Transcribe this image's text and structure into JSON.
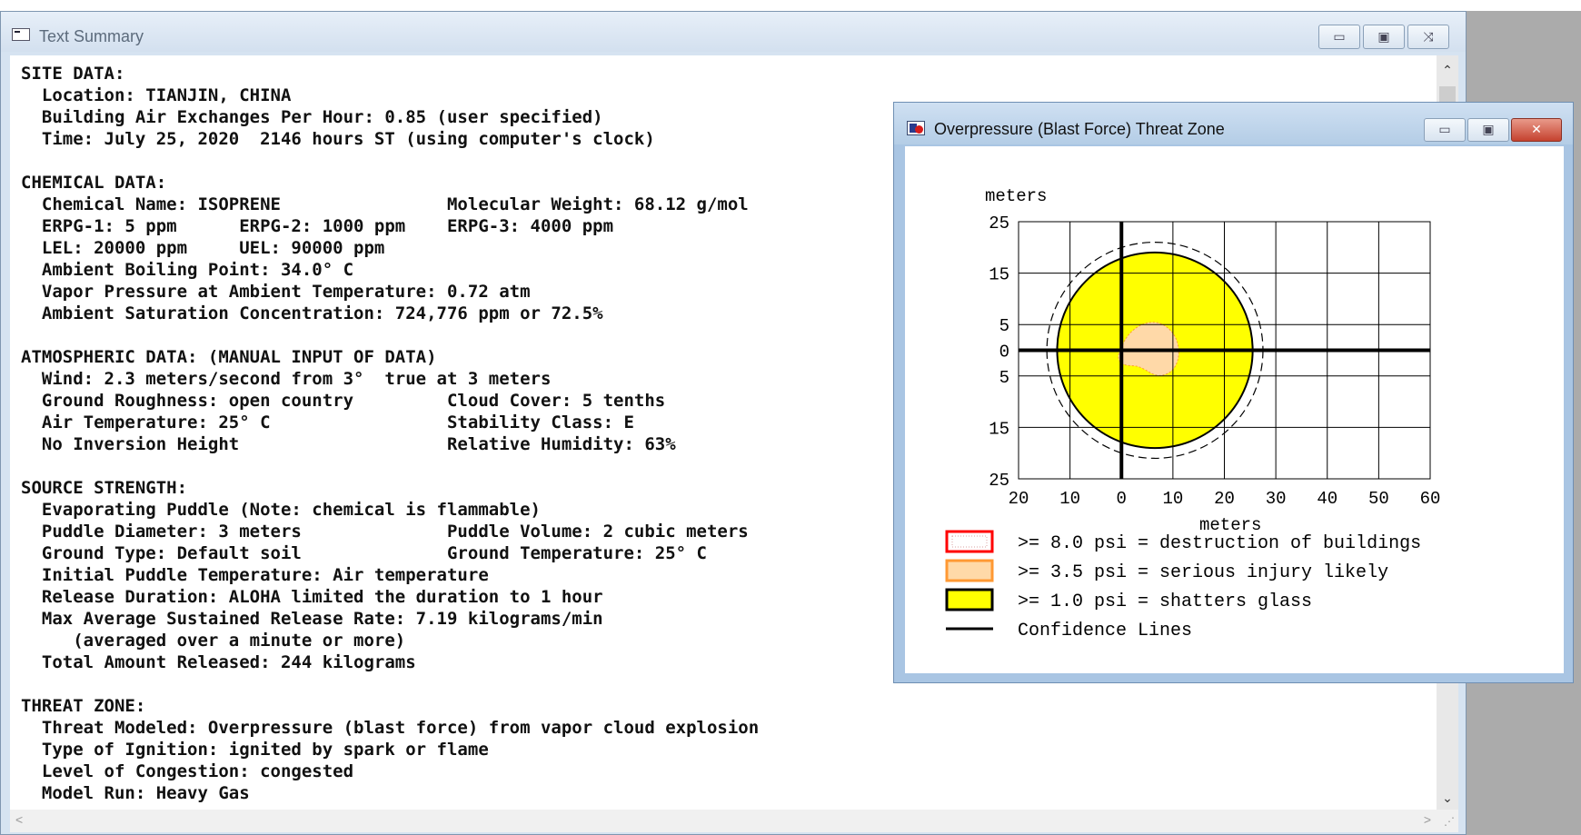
{
  "desktop_strip_text": "",
  "text_window": {
    "title": "Text Summary",
    "buttons": {
      "minimize": "▭",
      "maximize": "▣",
      "close": "⤨"
    },
    "lines": [
      "SITE DATA:",
      "  Location: TIANJIN, CHINA",
      "  Building Air Exchanges Per Hour: 0.85 (user specified)",
      "  Time: July 25, 2020  2146 hours ST (using computer's clock)",
      "",
      "CHEMICAL DATA:",
      "  Chemical Name: ISOPRENE                Molecular Weight: 68.12 g/mol",
      "  ERPG-1: 5 ppm      ERPG-2: 1000 ppm    ERPG-3: 4000 ppm",
      "  LEL: 20000 ppm     UEL: 90000 ppm",
      "  Ambient Boiling Point: 34.0° C",
      "  Vapor Pressure at Ambient Temperature: 0.72 atm",
      "  Ambient Saturation Concentration: 724,776 ppm or 72.5%",
      "",
      "ATMOSPHERIC DATA: (MANUAL INPUT OF DATA)",
      "  Wind: 2.3 meters/second from 3°  true at 3 meters",
      "  Ground Roughness: open country         Cloud Cover: 5 tenths",
      "  Air Temperature: 25° C                 Stability Class: E",
      "  No Inversion Height                    Relative Humidity: 63%",
      "",
      "SOURCE STRENGTH:",
      "  Evaporating Puddle (Note: chemical is flammable)",
      "  Puddle Diameter: 3 meters              Puddle Volume: 2 cubic meters",
      "  Ground Type: Default soil              Ground Temperature: 25° C",
      "  Initial Puddle Temperature: Air temperature",
      "  Release Duration: ALOHA limited the duration to 1 hour",
      "  Max Average Sustained Release Rate: 7.19 kilograms/min",
      "     (averaged over a minute or more)",
      "  Total Amount Released: 244 kilograms",
      "",
      "THREAT ZONE:",
      "  Threat Modeled: Overpressure (blast force) from vapor cloud explosion",
      "  Type of Ignition: ignited by spark or flame",
      "  Level of Congestion: congested",
      "  Model Run: Heavy Gas"
    ]
  },
  "threat_window": {
    "title": "Overpressure (Blast Force) Threat Zone",
    "buttons": {
      "minimize": "▭",
      "maximize": "▣",
      "close": "✕"
    }
  },
  "chart_data": {
    "type": "scatter",
    "y_axis_label": "meters",
    "x_axis_label": "meters",
    "xlim": [
      -20,
      60
    ],
    "ylim": [
      -25,
      25
    ],
    "x_ticks": [
      -20,
      -10,
      0,
      10,
      20,
      30,
      40,
      50,
      60
    ],
    "x_tick_labels": [
      "20",
      "10",
      "0",
      "10",
      "20",
      "30",
      "40",
      "50",
      "60"
    ],
    "y_ticks": [
      25,
      15,
      5,
      0,
      -5,
      -15,
      -25
    ],
    "y_tick_labels": [
      "25",
      "15",
      "5",
      "0",
      "5",
      "15",
      "25"
    ],
    "grid": true,
    "zones": [
      {
        "label": ">= 8.0 psi = destruction of buildings",
        "color": "#ff0000",
        "fill": "none",
        "center_x": 0,
        "center_y": 0,
        "radius": 0
      },
      {
        "label": ">= 3.5 psi = serious injury likely",
        "color": "#ff9933",
        "fill": "#ffd9a8",
        "center_x": 6,
        "center_y": 0,
        "radius": 6
      },
      {
        "label": ">= 1.0 psi = shatters glass",
        "color": "#000000",
        "fill": "#ffff00",
        "center_x": 6.5,
        "center_y": 0,
        "radius": 19
      }
    ],
    "confidence_lines": {
      "label": "Confidence Lines",
      "center_x": 6.5,
      "center_y": 0,
      "radius": 21
    },
    "legend": [
      {
        "label": ">= 8.0 psi = destruction of buildings",
        "swatch_fill": "#ffffff",
        "swatch_border": "#ff0000"
      },
      {
        "label": ">= 3.5 psi = serious injury likely",
        "swatch_fill": "#ffd9a8",
        "swatch_border": "#ff9933"
      },
      {
        "label": ">= 1.0 psi = shatters glass",
        "swatch_fill": "#ffff00",
        "swatch_border": "#000000"
      },
      {
        "label": "Confidence Lines",
        "swatch_fill": "none",
        "swatch_border": "#000000"
      }
    ]
  }
}
